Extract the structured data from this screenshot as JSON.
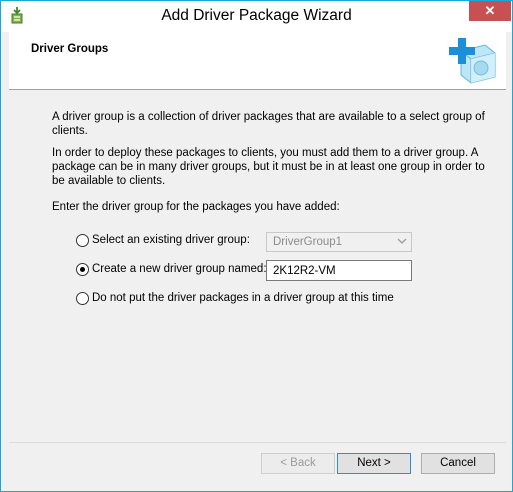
{
  "window": {
    "title": "Add Driver Package Wizard",
    "close_label": "✕"
  },
  "header": {
    "title": "Driver Groups"
  },
  "content": {
    "paragraph1": "A driver group is a collection of driver packages that are available to a select group of clients.",
    "paragraph2": "In order to deploy these packages to clients, you must add them to a driver group. A package can be in many driver groups, but it must be in at least one group in order to be available to clients.",
    "prompt": "Enter the driver group for the packages you have added:",
    "options": [
      {
        "label": "Select an existing driver group:",
        "checked": false
      },
      {
        "label": "Create a new driver group named:",
        "checked": true
      },
      {
        "label": "Do not put the driver packages in a driver group at this time",
        "checked": false
      }
    ],
    "existing_group_value": "DriverGroup1",
    "new_group_value": "2K12R2-VM"
  },
  "buttons": {
    "back": "< Back",
    "next": "Next >",
    "cancel": "Cancel"
  },
  "colors": {
    "window_border": "#17a8d8",
    "close_button": "#c75050",
    "default_button_border": "#2d8fd5"
  }
}
